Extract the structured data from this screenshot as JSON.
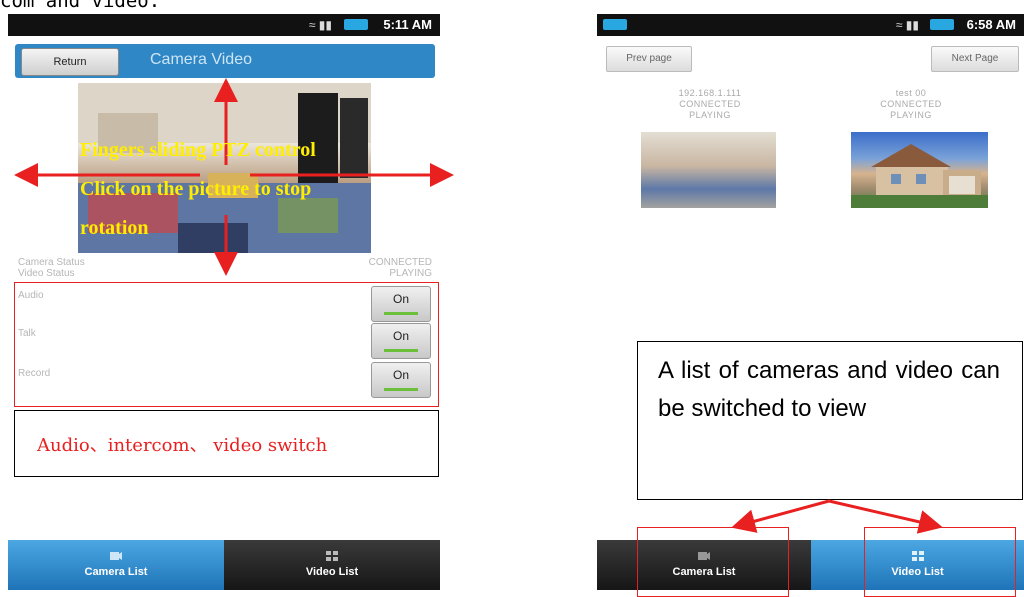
{
  "caption": "com and video.",
  "left_phone": {
    "status_time": "5:11 AM",
    "return_label": "Return",
    "title": "Camera Video",
    "camera_status_label": "Camera Status",
    "video_status_label": "Video Status",
    "camera_status_value": "CONNECTED",
    "video_status_value": "PLAYING",
    "controls": [
      {
        "label": "Audio",
        "button": "On"
      },
      {
        "label": "Talk",
        "button": "On"
      },
      {
        "label": "Record",
        "button": "On"
      }
    ],
    "tabs": [
      {
        "label": "Camera List",
        "icon": "camera-list-icon",
        "active": true
      },
      {
        "label": "Video List",
        "icon": "grid-icon",
        "active": false
      }
    ]
  },
  "right_phone": {
    "status_time": "6:58 AM",
    "prev_page": "Prev page",
    "next_page": "Next Page",
    "cameras": [
      {
        "name": "192.168.1.111",
        "status": "CONNECTED",
        "play": "PLAYING"
      },
      {
        "name": "test 00",
        "status": "CONNECTED",
        "play": "PLAYING"
      }
    ],
    "tabs": [
      {
        "label": "Camera List",
        "icon": "camera-list-icon",
        "active": false
      },
      {
        "label": "Video List",
        "icon": "grid-icon",
        "active": true
      }
    ]
  },
  "annotations": {
    "ptz_line1": "Fingers sliding PTZ control",
    "ptz_line2": "Click on the picture to stop",
    "ptz_line3": "rotation",
    "switch_note": "Audio、intercom、 video switch",
    "list_note": "A list of cameras and video can be switched to view"
  },
  "colors": {
    "accent_blue": "#2f87c5",
    "annotation_red": "#e82020",
    "annotation_yellow": "#ffee00",
    "toggle_green": "#6bbf3a"
  }
}
